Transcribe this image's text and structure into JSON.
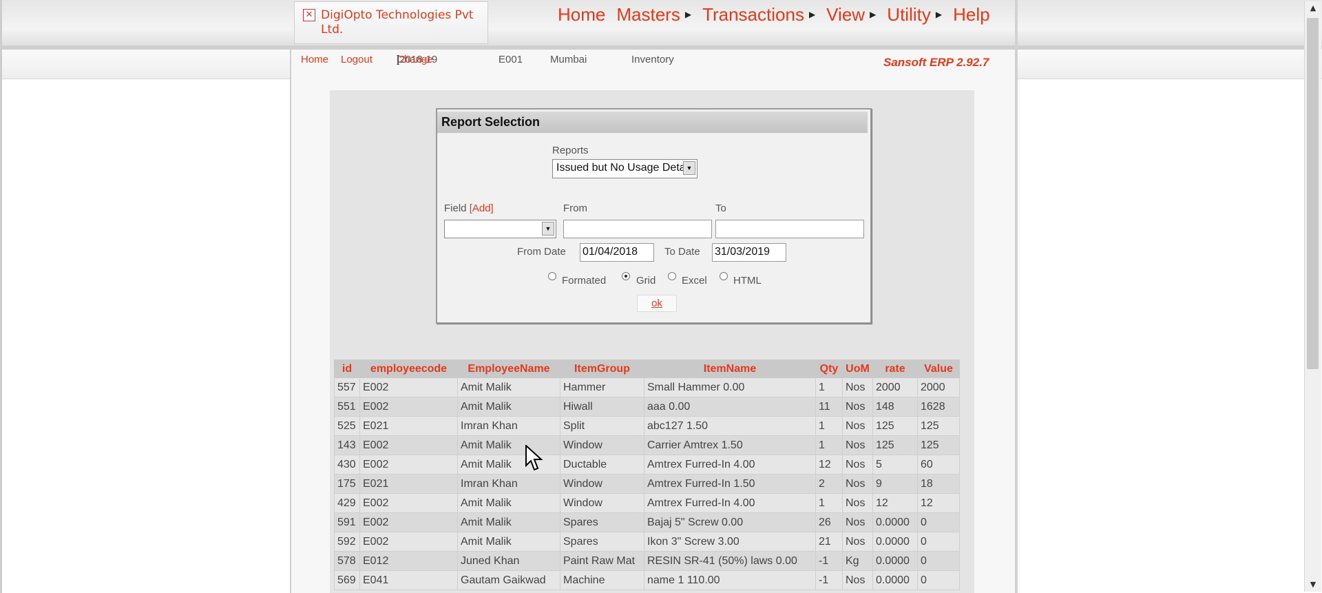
{
  "company": {
    "name": "DigiOpto Technologies Pvt Ltd.",
    "close_icon": "✕"
  },
  "menu": [
    {
      "label": "Home",
      "has_arrow": false
    },
    {
      "label": "Masters",
      "has_arrow": true
    },
    {
      "label": "Transactions",
      "has_arrow": true
    },
    {
      "label": "View",
      "has_arrow": true
    },
    {
      "label": "Utility",
      "has_arrow": true
    },
    {
      "label": "Help",
      "has_arrow": false
    }
  ],
  "subnav": {
    "home": "Home",
    "logout": "Logout",
    "year_prefix": "[2018-19",
    "change": "Change",
    "year_suffix": "]",
    "emp_code": "E001",
    "city": "Mumbai",
    "module": "Inventory",
    "version": "Sansoft ERP 2.92.7"
  },
  "dialog": {
    "title": "Report Selection",
    "reports_label": "Reports",
    "report_selected": "Issued but No Usage Details",
    "field_label": "Field",
    "add_label": "[Add]",
    "field_value": "",
    "from_label": "From",
    "from_value": "",
    "to_label": "To",
    "to_value": "",
    "from_date_label": "From Date",
    "from_date": "01/04/2018",
    "to_date_label": "To Date",
    "to_date": "31/03/2019",
    "formats": [
      {
        "label": "Formated",
        "selected": false
      },
      {
        "label": "Grid",
        "selected": true
      },
      {
        "label": "Excel",
        "selected": false
      },
      {
        "label": "HTML",
        "selected": false
      }
    ],
    "ok_label": "ok"
  },
  "grid": {
    "columns": [
      "id",
      "employeecode",
      "EmployeeName",
      "ItemGroup",
      "ItemName",
      "Qty",
      "UoM",
      "rate",
      "Value"
    ],
    "rows": [
      [
        "557",
        "E002",
        "Amit Malik",
        "Hammer",
        "Small Hammer 0.00",
        "1",
        "Nos",
        "2000",
        "2000"
      ],
      [
        "551",
        "E002",
        "Amit Malik",
        "Hiwall",
        "aaa 0.00",
        "11",
        "Nos",
        "148",
        "1628"
      ],
      [
        "525",
        "E021",
        "Imran Khan",
        "Split",
        "abc127 1.50",
        "1",
        "Nos",
        "125",
        "125"
      ],
      [
        "143",
        "E002",
        "Amit Malik",
        "Window",
        "Carrier Amtrex 1.50",
        "1",
        "Nos",
        "125",
        "125"
      ],
      [
        "430",
        "E002",
        "Amit Malik",
        "Ductable",
        "Amtrex Furred-In 4.00",
        "12",
        "Nos",
        "5",
        "60"
      ],
      [
        "175",
        "E021",
        "Imran Khan",
        "Window",
        "Amtrex Furred-In 1.50",
        "2",
        "Nos",
        "9",
        "18"
      ],
      [
        "429",
        "E002",
        "Amit Malik",
        "Window",
        "Amtrex Furred-In 4.00",
        "1",
        "Nos",
        "12",
        "12"
      ],
      [
        "591",
        "E002",
        "Amit Malik",
        "Spares",
        "Bajaj 5\" Screw 0.00",
        "26",
        "Nos",
        "0.0000",
        "0"
      ],
      [
        "592",
        "E002",
        "Amit Malik",
        "Spares",
        "Ikon 3\" Screw 3.00",
        "21",
        "Nos",
        "0.0000",
        "0"
      ],
      [
        "578",
        "E012",
        "Juned Khan",
        "Paint Raw Mat",
        "RESIN SR-41 (50%) laws 0.00",
        "-1",
        "Kg",
        "0.0000",
        "0"
      ],
      [
        "569",
        "E041",
        "Gautam Gaikwad",
        "Machine",
        "name 1 110.00",
        "-1",
        "Nos",
        "0.0000",
        "0"
      ]
    ]
  }
}
